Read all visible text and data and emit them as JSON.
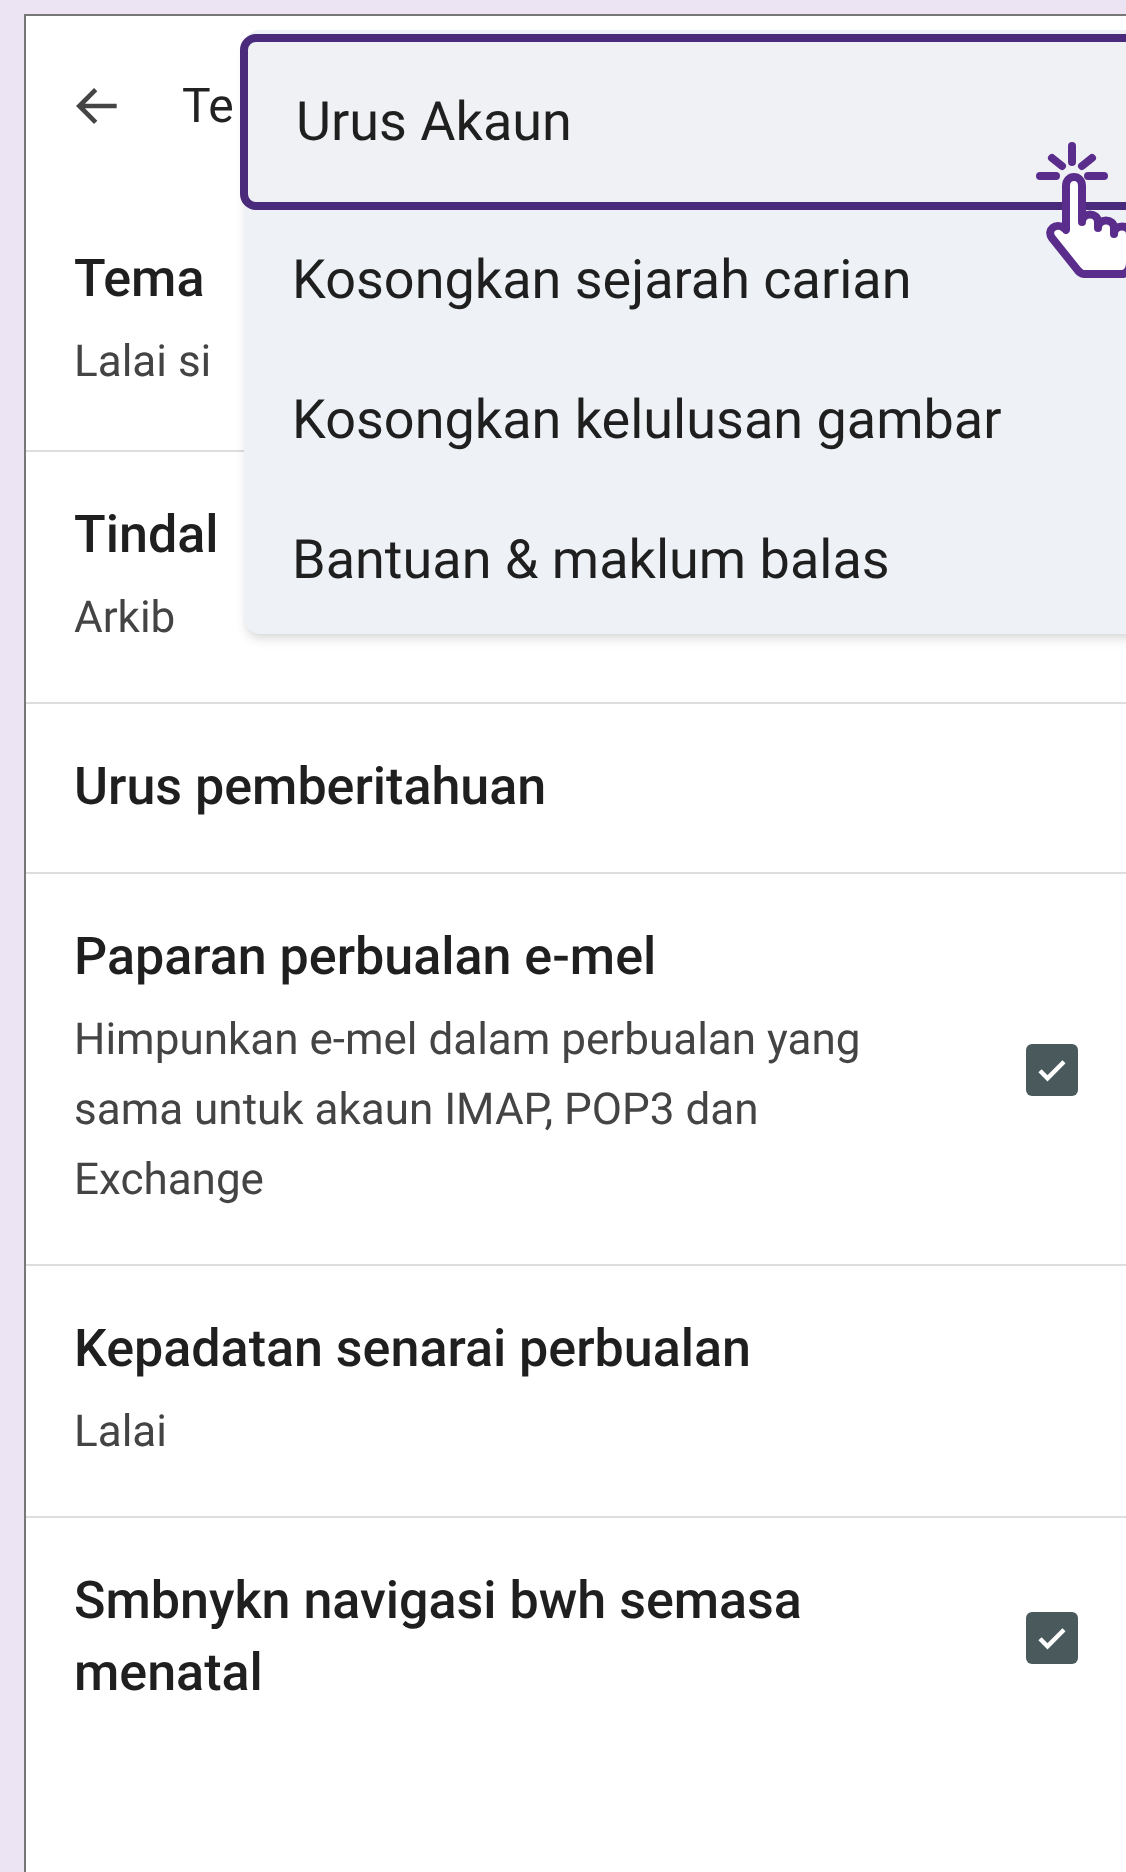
{
  "header": {
    "title": "Te"
  },
  "settings": [
    {
      "kind": "text",
      "title": "Tema",
      "subtitle": "Lalai si"
    },
    {
      "kind": "text",
      "title": "Tindal",
      "subtitle": "Arkib"
    },
    {
      "kind": "text",
      "title": "Urus pemberitahuan"
    },
    {
      "kind": "checkbox",
      "title": "Paparan perbualan e-mel",
      "subtitle": "Himpunkan e-mel dalam perbualan yang sama untuk akaun IMAP, POP3 dan Exchange",
      "checked": true
    },
    {
      "kind": "text",
      "title": "Kepadatan senarai perbualan",
      "subtitle": "Lalai"
    },
    {
      "kind": "checkbox",
      "title": "Smbnykn navigasi bwh semasa menatal",
      "checked": true
    }
  ],
  "menu": [
    {
      "label": "Urus Akaun",
      "selected": true
    },
    {
      "label": "Kosongkan sejarah carian",
      "selected": false
    },
    {
      "label": "Kosongkan kelulusan gambar",
      "selected": false
    },
    {
      "label": "Bantuan & maklum balas",
      "selected": false
    }
  ]
}
